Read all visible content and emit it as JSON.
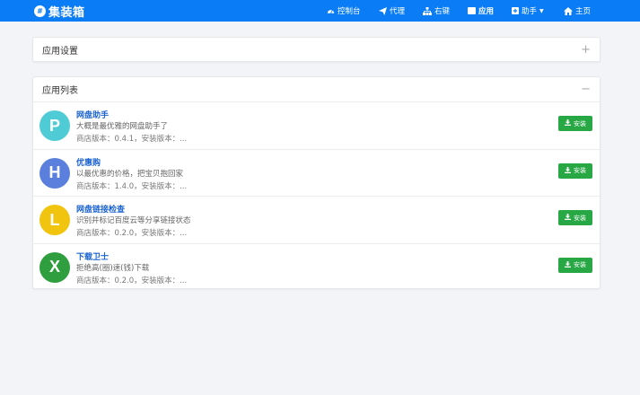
{
  "navbar": {
    "brand_logo": "#",
    "brand_name": "集装箱",
    "items": [
      {
        "label": "控制台",
        "icon": "dashboard-icon"
      },
      {
        "label": "代理",
        "icon": "paper-plane-icon"
      },
      {
        "label": "右键",
        "icon": "sitemap-icon"
      },
      {
        "label": "应用",
        "icon": "window-icon",
        "active": true
      },
      {
        "label": "助手",
        "icon": "plus-square-icon"
      },
      {
        "label": "主页",
        "icon": "home-icon"
      }
    ]
  },
  "settings_card": {
    "title": "应用设置",
    "tool": "+"
  },
  "list_card": {
    "title": "应用列表",
    "tool": "−",
    "apps": [
      {
        "letter": "P",
        "color": "#4ecbd4",
        "name": "网盘助手",
        "desc": "大概是最优雅的网盘助手了",
        "meta": "商店版本：0.4.1，安装版本：...",
        "button": "安装"
      },
      {
        "letter": "H",
        "color": "#5b7fdc",
        "name": "优惠购",
        "desc": "以最优惠的价格，把宝贝抱回家",
        "meta": "商店版本：1.4.0，安装版本：...",
        "button": "安装"
      },
      {
        "letter": "L",
        "color": "#f1c40f",
        "name": "网盘链接检查",
        "desc": "识别并标记百度云等分享链接状态",
        "meta": "商店版本：0.2.0，安装版本：...",
        "button": "安装"
      },
      {
        "letter": "X",
        "color": "#2e9e3e",
        "name": "下载卫士",
        "desc": "拒绝高(圈)速(钱)下载",
        "meta": "商店版本：0.2.0，安装版本：...",
        "button": "安装"
      }
    ]
  },
  "colors": {
    "navbar": "#0a7cf5",
    "install": "#28a745",
    "link": "#1c64d1"
  }
}
